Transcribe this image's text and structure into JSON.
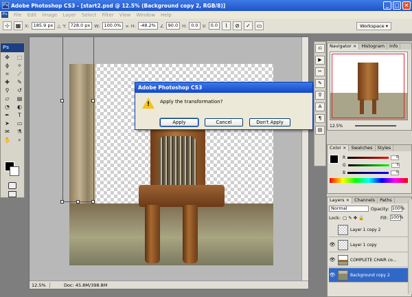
{
  "window": {
    "title": "Adobe Photoshop CS3 - [start2.psd @ 12.5% (Background copy 2, RGB/8)]",
    "logo": "Ps",
    "buttons": {
      "minimize": "_",
      "maximize": "□",
      "close": "×"
    }
  },
  "menubar": {
    "items": [
      "File",
      "Edit",
      "Image",
      "Layer",
      "Select",
      "Filter",
      "View",
      "Window",
      "Help"
    ]
  },
  "options": {
    "x_label": "X:",
    "x_value": "185.9 px",
    "y_label": "Y:",
    "y_value": "728.0 px",
    "w_label": "W:",
    "w_value": "100.0%",
    "h_label": "H:",
    "h_value": "-48.2%",
    "angle_value": "90.0",
    "hskew_label": "H:",
    "hskew_value": "0.0",
    "vskew_label": "V:",
    "vskew_value": "0.0",
    "workspace": "Workspace ▾"
  },
  "toolbox": {
    "logo": "Ps"
  },
  "status": {
    "zoom": "12.5%",
    "doc": "Doc: 45.8M/398.8M"
  },
  "dialog": {
    "title": "Adobe Photoshop CS3",
    "icon": "!",
    "message": "Apply the transformation?",
    "apply": "Apply",
    "cancel": "Cancel",
    "dont_apply": "Don't Apply"
  },
  "navigator": {
    "tabs": [
      "Navigator ×",
      "Histogram",
      "Info"
    ],
    "zoom": "12.5%"
  },
  "color": {
    "tabs": [
      "Color ×",
      "Swatches",
      "Styles"
    ],
    "r_label": "R",
    "r_value": "0",
    "g_label": "G",
    "g_value": "0",
    "b_label": "B",
    "b_value": "0"
  },
  "layers": {
    "tabs": [
      "Layers ×",
      "Channels",
      "Paths"
    ],
    "blend_mode": "Normal",
    "opacity_label": "Opacity:",
    "opacity_value": "100%",
    "lock_label": "Lock:",
    "fill_label": "Fill:",
    "fill_value": "100%",
    "items": [
      {
        "name": "Layer 1 copy 2",
        "visible": false,
        "active": false
      },
      {
        "name": "Layer 1 copy",
        "visible": true,
        "active": false
      },
      {
        "name": "COMPLETE CHAIR co...",
        "visible": true,
        "active": false
      },
      {
        "name": "Background copy 2",
        "visible": true,
        "active": true
      }
    ]
  }
}
